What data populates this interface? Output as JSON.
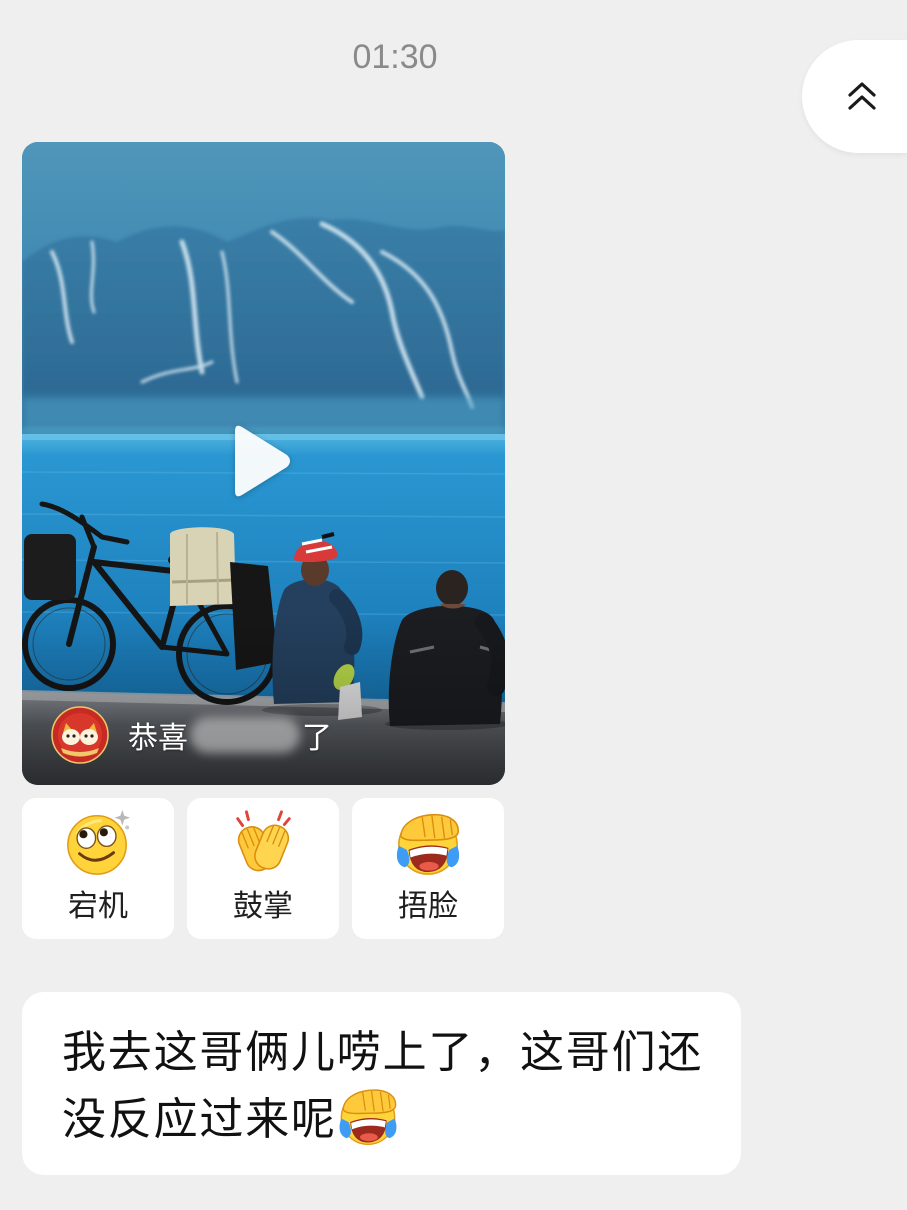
{
  "timestamp": "01:30",
  "scroll_top": {
    "icon": "double-chevron-up-icon"
  },
  "video": {
    "play_icon": "play-icon",
    "avatar_icon": "avatar",
    "caption_start": "恭喜",
    "caption_end": "了"
  },
  "reactions": [
    {
      "label": "宕机",
      "icon": "dizzy-face-icon"
    },
    {
      "label": "鼓掌",
      "icon": "clapping-hands-icon"
    },
    {
      "label": "捂脸",
      "icon": "facepalm-icon"
    }
  ],
  "comment": {
    "lines": [
      "我去这哥俩儿唠上了，这哥们还",
      "没反应过来呢"
    ],
    "trailing_emoji": "facepalm-icon"
  },
  "colors": {
    "background": "#efefef",
    "card": "#ffffff",
    "timestamp": "#8a8a8a",
    "text": "#111111",
    "caption": "#ffffff"
  }
}
